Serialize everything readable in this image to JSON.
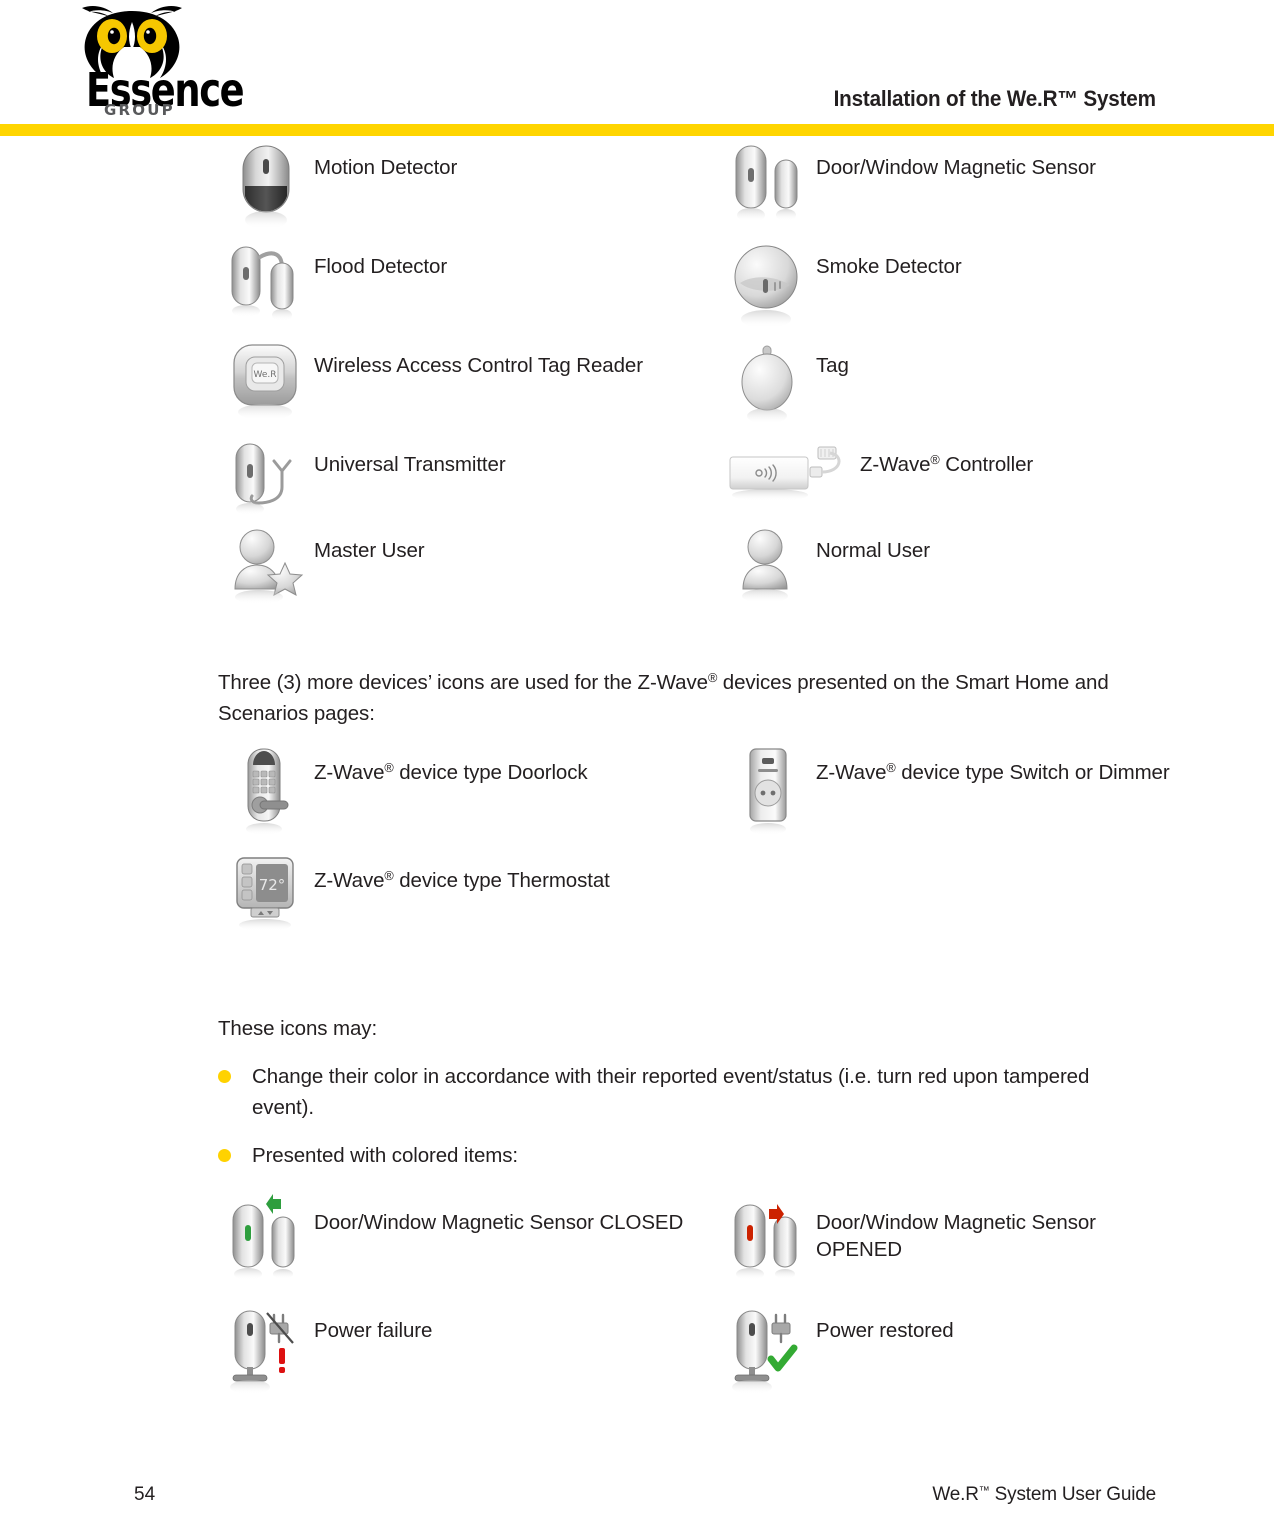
{
  "header": {
    "logo": {
      "brand": "Essence",
      "sub": "GROUP",
      "icon": "owl-logo"
    },
    "title": "Installation of the We.R™ System",
    "rule_color": "#ffd500"
  },
  "devices_table": {
    "rows": [
      {
        "left": {
          "icon": "motion-detector-icon",
          "label": "Motion Detector"
        },
        "right": {
          "icon": "door-window-magnetic-sensor-icon",
          "label": "Door/Window Magnetic Sensor"
        }
      },
      {
        "left": {
          "icon": "flood-detector-icon",
          "label": "Flood Detector"
        },
        "right": {
          "icon": "smoke-detector-icon",
          "label": "Smoke Detector"
        }
      },
      {
        "left": {
          "icon": "tag-reader-icon",
          "label": "Wireless Access Control Tag Reader"
        },
        "right": {
          "icon": "tag-icon",
          "label": "Tag"
        }
      },
      {
        "left": {
          "icon": "universal-transmitter-icon",
          "label": "Universal Transmitter"
        },
        "right": {
          "icon": "z-wave-controller-icon",
          "label_pre": "Z-Wave",
          "label_sup": "®",
          "label_post": " Controller"
        }
      },
      {
        "left": {
          "icon": "master-user-icon",
          "label": "Master User"
        },
        "right": {
          "icon": "normal-user-icon",
          "label": "Normal User"
        }
      }
    ]
  },
  "paragraph": {
    "pre": "Three (3) more devices’ icons are used for the Z-Wave",
    "sup": "®",
    "post": " devices presented on the Smart Home and Scenarios pages:"
  },
  "zwave_devices": {
    "rows": [
      {
        "left": {
          "icon": "z-wave-doorlock-icon",
          "pre": "Z-Wave",
          "sup": "®",
          "post": " device type Doorlock"
        },
        "right": {
          "icon": "z-wave-switch-dimmer-icon",
          "pre": "Z-Wave",
          "sup": "®",
          "post": " device type Switch or Dimmer"
        }
      },
      {
        "left": {
          "icon": "z-wave-thermostat-icon",
          "pre": "Z-Wave",
          "sup": "®",
          "post": " device type Thermostat"
        },
        "right": null
      }
    ],
    "thermostat_display": "72°"
  },
  "icons_may": {
    "lead": "These icons may:",
    "bullet_color": "#ffd200",
    "bullets": [
      "Change their color in accordance with their reported event/status (i.e. turn red upon tampered event).",
      "Presented with colored items:"
    ]
  },
  "status_icons": {
    "rows": [
      {
        "left": {
          "icon": "door-window-sensor-closed-icon",
          "label": "Door/Window Magnetic Sensor CLOSED",
          "accent": "#2e9e3e"
        },
        "right": {
          "icon": "door-window-sensor-opened-icon",
          "label": "Door/Window Magnetic Sensor OPENED",
          "accent": "#cc2200"
        }
      },
      {
        "left": {
          "icon": "power-failure-icon",
          "label": "Power failure",
          "accent": "#dd1111"
        },
        "right": {
          "icon": "power-restored-icon",
          "label": "Power restored",
          "accent": "#33aa33"
        }
      }
    ]
  },
  "footer": {
    "page_number": "54",
    "pre": "We.R",
    "sup": "™",
    "post": " System User Guide"
  }
}
